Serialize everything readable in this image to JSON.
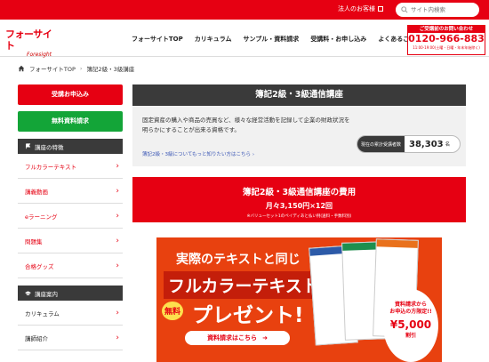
{
  "topbar": {
    "corporate_label": "法人のお客様",
    "search_placeholder": "サイト内検索"
  },
  "header": {
    "logo_jp": "フォーサイト",
    "logo_en": "Foresight",
    "nav": [
      "フォーサイトTOP",
      "カリキュラム",
      "サンプル・資料請求",
      "受講料・お申し込み",
      "よくあるご質問"
    ],
    "tel_label": "ご受講前のお問い合わせ",
    "tel_number": "0120-966-883",
    "tel_hours": "11:00-19:00(土曜・日曜・年末年始除く)"
  },
  "breadcrumb": {
    "home": "フォーサイトTOP",
    "current": "簿記2級・3級講座"
  },
  "sidebar": {
    "apply_button": "受講お申込み",
    "request_button": "無料資料請求",
    "features_heading": "講座の特徴",
    "features": [
      "フルカラーテキスト",
      "講義動画",
      "eラーニング",
      "問題集",
      "合格グッズ"
    ],
    "guide_heading": "講座案内",
    "guide": [
      "カリキュラム",
      "講師紹介"
    ]
  },
  "main": {
    "title": "簿記2級・3級通信講座",
    "description": "固定資産の購入や商品の売買など、様々な経営活動を記録して企業の財政状況を明らかにすることが出来る資格です。",
    "more_link": "簿記2級・3級についてもっと知りたい方はこちら",
    "counter_label": "現在の累計受講者数",
    "counter_value": "38,303",
    "counter_unit": "名",
    "fee_heading": "簿記2級・3級通信講座の費用",
    "fee_price": "月々3,150円×12回",
    "fee_note": "※バリューセット1のペイディあと払い例(送料・手数料別)"
  },
  "banner": {
    "line1": "実際のテキストと同じ",
    "line2": "フルカラーテキスト",
    "line3": "プレゼント!",
    "free_badge": "無料",
    "request_link": "資料請求はこちら",
    "circle_line1": "資料請求から",
    "circle_line2": "お申込の方限定!!",
    "circle_price": "¥5,000",
    "circle_unit": "割引"
  }
}
